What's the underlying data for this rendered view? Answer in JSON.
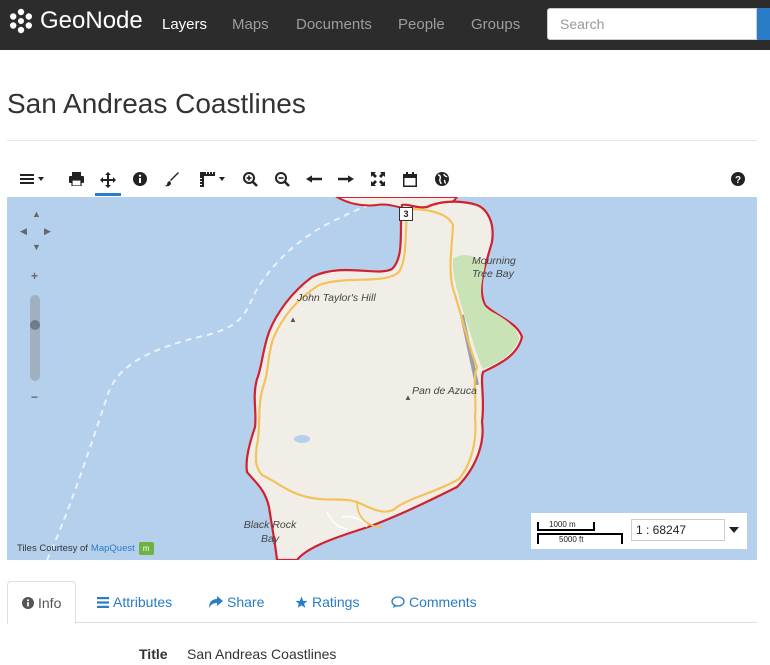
{
  "brand": {
    "name": "GeoNode"
  },
  "nav": {
    "items": [
      "Layers",
      "Maps",
      "Documents",
      "People",
      "Groups"
    ],
    "active": "Layers"
  },
  "search": {
    "placeholder": "Search"
  },
  "page": {
    "title": "San Andreas Coastlines"
  },
  "toolbar": {
    "icons": [
      "menu-icon",
      "print-icon",
      "pan-icon",
      "info-icon",
      "paintbrush-icon",
      "measure-icon",
      "zoom-in-icon",
      "zoom-out-icon",
      "arrow-left-icon",
      "arrow-right-icon",
      "fullscreen-icon",
      "calendar-icon",
      "globe-icon",
      "help-icon"
    ],
    "active": "pan-icon"
  },
  "map": {
    "labels": {
      "john_taylors_hill": "John Taylor's Hill",
      "mourning_tree_bay": "Mourning Tree Bay",
      "pan_de_azucar": "Pan de Azuca",
      "black_rock_bay": "Black Rock Bay",
      "road_shield": "3"
    },
    "attribution": {
      "prefix": "Tiles Courtesy of",
      "link": "MapQuest"
    },
    "scale": {
      "metric": "1000 m",
      "imperial": "5000 ft",
      "ratio": "1 : 68247"
    },
    "colors": {
      "water": "#b5d0ed",
      "land": "#f1eee7",
      "coast": "#d2202f",
      "road": "#f3c25a",
      "park": "#c9e3b6"
    }
  },
  "tabs": [
    {
      "label": "Info",
      "icon": "info-circle-icon",
      "active": true
    },
    {
      "label": "Attributes",
      "icon": "list-icon",
      "active": false
    },
    {
      "label": "Share",
      "icon": "share-icon",
      "active": false
    },
    {
      "label": "Ratings",
      "icon": "star-icon",
      "active": false
    },
    {
      "label": "Comments",
      "icon": "comment-icon",
      "active": false
    }
  ],
  "info": {
    "title_key": "Title",
    "title_value": "San Andreas Coastlines"
  }
}
